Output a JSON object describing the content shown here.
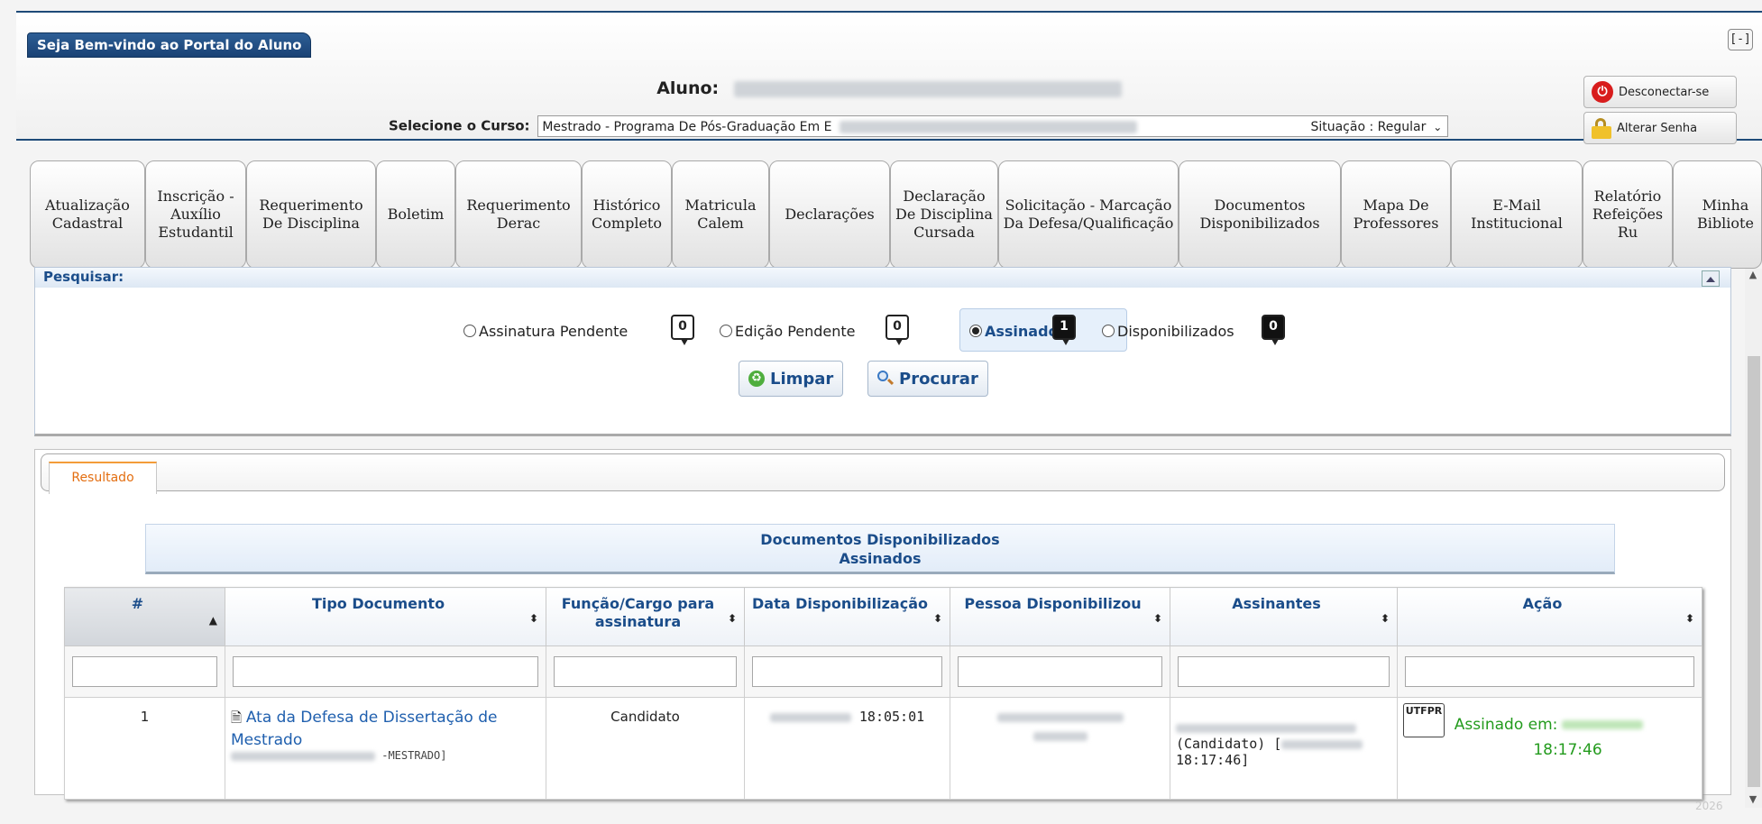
{
  "header": {
    "welcome_tab": "Seja Bem-vindo ao Portal do Aluno",
    "collapse_label": "[-]",
    "aluno_label": "Aluno:",
    "curso_label": "Selecione o Curso:",
    "curso_value": "Mestrado - Programa De Pós-Graduação Em E",
    "situacao": "Situação : Regular",
    "logout_label": "Desconectar-se",
    "password_label": "Alterar Senha"
  },
  "nav": [
    {
      "label": "Atualização Cadastral"
    },
    {
      "label": "Inscrição - Auxílio Estudantil"
    },
    {
      "label": "Requerimento De Disciplina"
    },
    {
      "label": "Boletim"
    },
    {
      "label": "Requerimento Derac"
    },
    {
      "label": "Histórico Completo"
    },
    {
      "label": "Matricula Calem"
    },
    {
      "label": "Declarações"
    },
    {
      "label": "Declaração De Disciplina Cursada"
    },
    {
      "label": "Solicitação - Marcação Da Defesa/Qualificação"
    },
    {
      "label": "Documentos Disponibilizados"
    },
    {
      "label": "Mapa De Professores"
    },
    {
      "label": "E-Mail Institucional"
    },
    {
      "label": "Relatório Refeições Ru"
    },
    {
      "label": "Minha Bibliote"
    }
  ],
  "search": {
    "title": "Pesquisar:",
    "options": [
      {
        "label": "Assinatura Pendente",
        "count": "0",
        "checked": false
      },
      {
        "label": "Edição Pendente",
        "count": "0",
        "checked": false
      },
      {
        "label": "Assinados",
        "count": "1",
        "checked": true
      },
      {
        "label": "Disponibilizados",
        "count": "0",
        "checked": false
      }
    ],
    "limpar_label": "Limpar",
    "procurar_label": "Procurar"
  },
  "result": {
    "tab_label": "Resultado",
    "caption_line1": "Documentos Disponibilizados",
    "caption_line2": "Assinados",
    "columns": [
      "#",
      "Tipo Documento",
      "Função/Cargo para assinatura",
      "Data Disponibilização",
      "Pessoa Disponibilizou",
      "Assinantes",
      "Ação"
    ],
    "rows": [
      {
        "num": "1",
        "tipo": "Ata da Defesa de Dissertação de Mestrado",
        "tipo_sub": "-MESTRADO]",
        "funcao": "Candidato",
        "data_time": "18:05:01",
        "assinantes_role": "(Candidato) [",
        "assinantes_time": "18:17:46]",
        "acao_label": "Assinado em:",
        "acao_time": "18:17:46",
        "logo_text": "UTFPR"
      }
    ]
  },
  "footer": {
    "year": "2026"
  },
  "colors": {
    "accent": "#1e4a78",
    "link": "#1f5fae",
    "success": "#239b1d",
    "tab_active": "#e36e11"
  },
  "icons": [
    "power-icon",
    "lock-icon",
    "recycle-icon",
    "magnifier-icon",
    "document-icon",
    "sort-icon",
    "utfpr-logo"
  ]
}
